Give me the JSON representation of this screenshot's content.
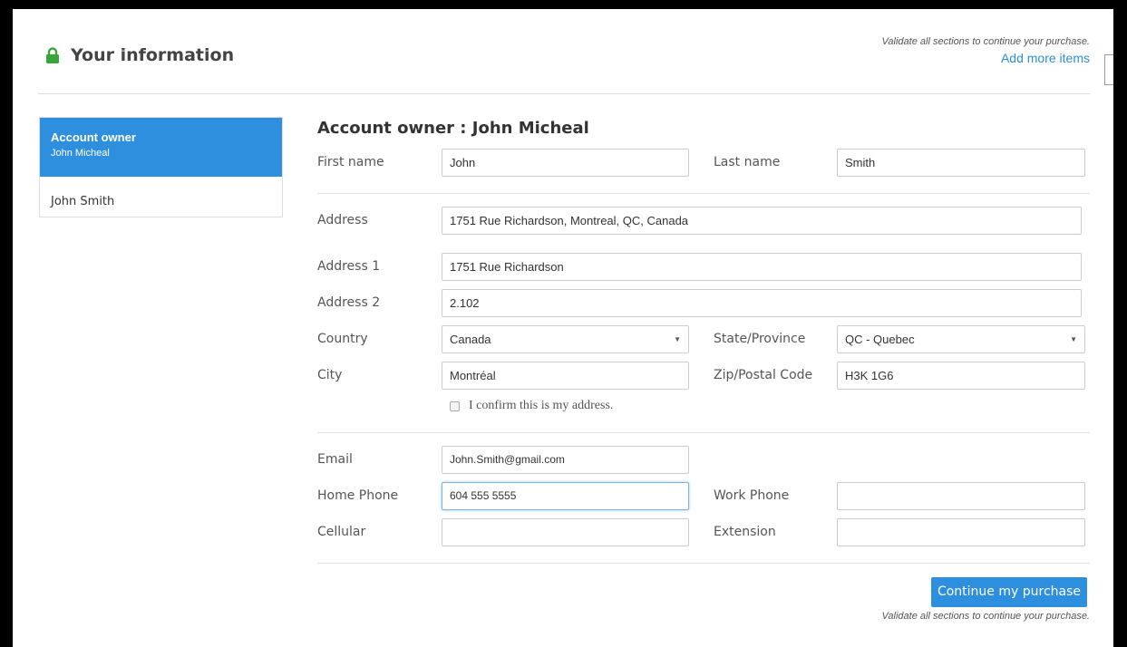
{
  "header": {
    "title": "Your information",
    "validate_note": "Validate all sections to continue your purchase.",
    "add_more_items": "Add more items"
  },
  "sidebar": {
    "items": [
      {
        "title": "Account owner",
        "subtitle": "John Micheal"
      },
      {
        "title": "John Smith"
      }
    ]
  },
  "form": {
    "section_title": "Account owner : John Micheal",
    "first_name": {
      "label": "First name",
      "value": "John"
    },
    "last_name": {
      "label": "Last name",
      "value": "Smith"
    },
    "address": {
      "label": "Address",
      "value": "1751 Rue Richardson, Montreal, QC, Canada"
    },
    "address1": {
      "label": "Address 1",
      "value": "1751 Rue Richardson"
    },
    "address2": {
      "label": "Address 2",
      "value": "2.102"
    },
    "country": {
      "label": "Country",
      "value": "Canada"
    },
    "state": {
      "label": "State/Province",
      "value": "QC - Quebec"
    },
    "city": {
      "label": "City",
      "value": "Montréal"
    },
    "zip": {
      "label": "Zip/Postal Code",
      "value": "H3K 1G6"
    },
    "confirm_address": "I confirm this is my address.",
    "email": {
      "label": "Email",
      "value": "John.Smith@gmail.com"
    },
    "home_phone": {
      "label": "Home Phone",
      "value": "604 555 5555"
    },
    "work_phone": {
      "label": "Work Phone",
      "value": ""
    },
    "cellular": {
      "label": "Cellular",
      "value": ""
    },
    "extension": {
      "label": "Extension",
      "value": ""
    }
  },
  "footer": {
    "continue_label": "Continue my purchase",
    "validate_note": "Validate all sections to continue your purchase."
  },
  "colors": {
    "accent": "#2e8fde",
    "lock": "#3aa63a"
  },
  "icons": {
    "lock": "lock-icon",
    "caret": "chevron-down-icon"
  }
}
